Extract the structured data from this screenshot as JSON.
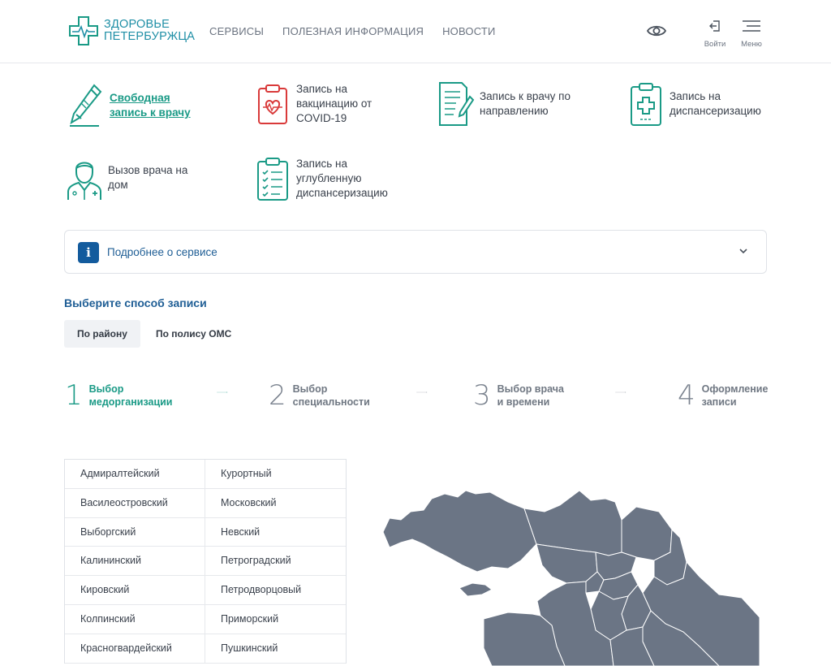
{
  "header": {
    "logo_line1": "ЗДОРОВЬЕ",
    "logo_line2": "ПЕТЕРБУРЖЦА",
    "nav": [
      "СЕРВИСЫ",
      "ПОЛЕЗНАЯ ИНФОРМАЦИЯ",
      "НОВОСТИ"
    ],
    "login_label": "Войти",
    "menu_label": "Меню"
  },
  "services": [
    {
      "label": "Свободная запись к врачу",
      "icon": "pen-icon"
    },
    {
      "label": "Запись на вакцинацию от COVID-19",
      "icon": "heart-clipboard-icon"
    },
    {
      "label": "Запись к врачу по направлению",
      "icon": "document-pen-icon"
    },
    {
      "label": "Запись на диспансеризацию",
      "icon": "medical-clipboard-icon"
    },
    {
      "label": "Вызов врача на дом",
      "icon": "doctor-icon"
    },
    {
      "label": "Запись на углубленную диспансеризацию",
      "icon": "checklist-icon"
    }
  ],
  "info_panel": {
    "badge": "i",
    "title": "Подробнее о сервисе"
  },
  "choose_title": "Выберите способ записи",
  "tabs": [
    "По району",
    "По полису ОМС"
  ],
  "steps": [
    {
      "num": "1",
      "line1": "Выбор",
      "line2": "медорганизации"
    },
    {
      "num": "2",
      "line1": "Выбор",
      "line2": "специальности"
    },
    {
      "num": "3",
      "line1": "Выбор врача",
      "line2": "и времени"
    },
    {
      "num": "4",
      "line1": "Оформление",
      "line2": "записи"
    }
  ],
  "districts": [
    [
      "Адмиралтейский",
      "Курортный"
    ],
    [
      "Василеостровский",
      "Московский"
    ],
    [
      "Выборгский",
      "Невский"
    ],
    [
      "Калининский",
      "Петроградский"
    ],
    [
      "Кировский",
      "Петродворцовый"
    ],
    [
      "Колпинский",
      "Приморский"
    ],
    [
      "Красногвардейский",
      "Пушкинский"
    ]
  ],
  "colors": {
    "accent": "#1a9a86",
    "primary": "#1f5e95",
    "covid": "#d93a3a",
    "map": "#6b7585"
  }
}
